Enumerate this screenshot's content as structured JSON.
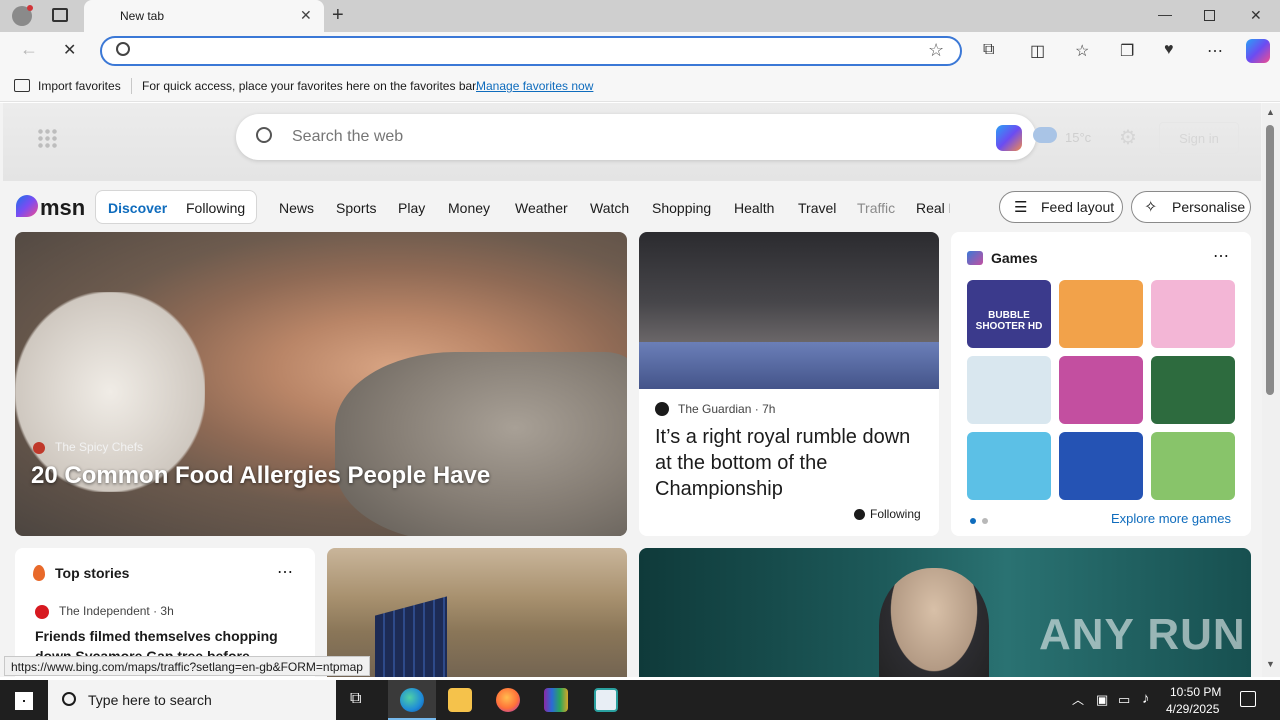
{
  "browser": {
    "tab_title": "New tab",
    "favbar": {
      "import_label": "Import favorites",
      "hint": "For quick access, place your favorites here on the favorites bar.",
      "manage_link": "Manage favorites now"
    }
  },
  "msn": {
    "search_placeholder": "Search the web",
    "temperature": "15°c",
    "signin_label": "Sign in",
    "logo_text": "msn",
    "tabs": [
      {
        "label": "Discover",
        "active": true
      },
      {
        "label": "Following",
        "active": false
      }
    ],
    "nav": [
      "News",
      "Sports",
      "Play",
      "Money",
      "Weather",
      "Watch",
      "Shopping",
      "Health",
      "Travel",
      "Traffic",
      "Real E"
    ],
    "feed_layout_label": "Feed layout",
    "personalise_label": "Personalise"
  },
  "hero": {
    "source": "The Spicy Chefs",
    "title": "20 Common Food Allergies People Have"
  },
  "story": {
    "source": "The Guardian",
    "age": "7h",
    "title": "It’s a right royal rumble down at the bottom of the Championship",
    "following_label": "Following"
  },
  "games": {
    "title": "Games",
    "more_label": "Explore more games",
    "tile_colors": [
      "#3b3a8c",
      "#f2a24a",
      "#f3b6d6",
      "#d9e7ef",
      "#c34fa0",
      "#2d6b3e",
      "#5cc0e6",
      "#2553b4",
      "#88c46a"
    ],
    "tile_label_1": "BUBBLE SHOOTER HD"
  },
  "top_stories": {
    "title": "Top stories",
    "source": "The Independent",
    "age": "3h",
    "headline": "Friends filmed themselves chopping down Sycamore Gap tree before"
  },
  "watermark": "ANY RUN",
  "status_url": "https://www.bing.com/maps/traffic?setlang=en-gb&FORM=ntpmap",
  "taskbar": {
    "search_placeholder": "Type here to search",
    "time": "10:50 PM",
    "date": "4/29/2025"
  }
}
